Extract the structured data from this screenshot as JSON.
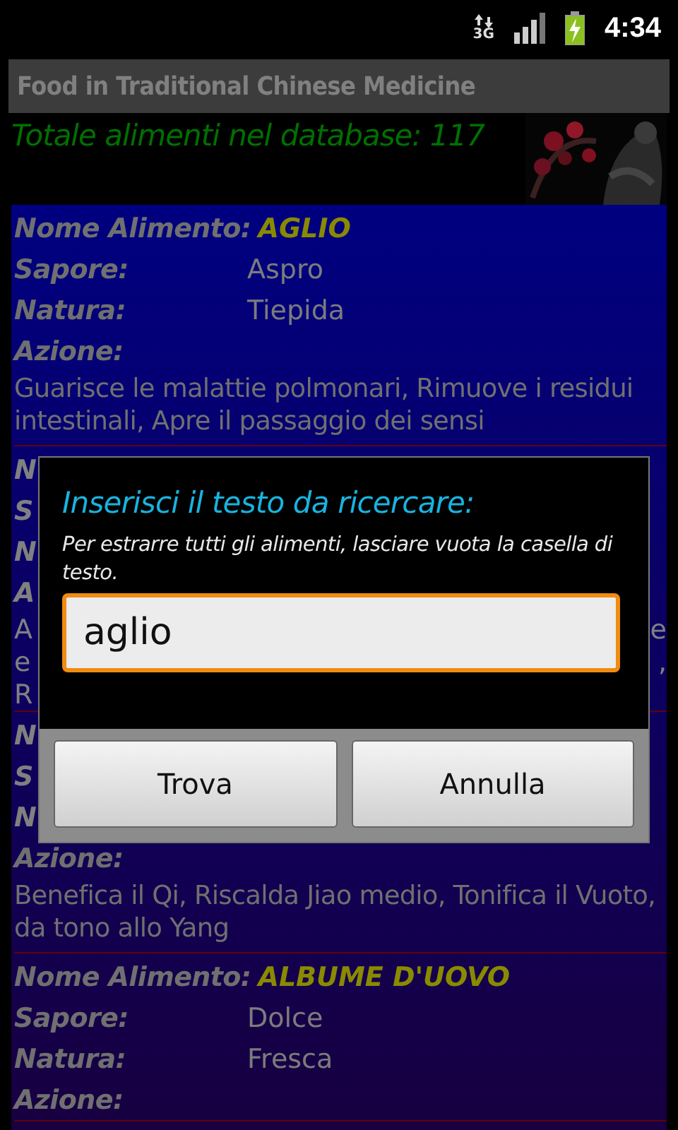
{
  "status_bar": {
    "network": "3G",
    "time": "4:34"
  },
  "window": {
    "title": "Food in Traditional Chinese Medicine"
  },
  "summary": "Totale alimenti nel database: 117",
  "entries": [
    {
      "rows": [
        {
          "kind": "name",
          "label": "Nome Alimento:",
          "value": "AGLIO"
        },
        {
          "kind": "field",
          "label": "Sapore:",
          "value": "Aspro"
        },
        {
          "kind": "field",
          "label": "Natura:",
          "value": "Tiepida"
        },
        {
          "kind": "heading",
          "label": "Azione:"
        },
        {
          "kind": "text",
          "text": "Guarisce le malattie polmonari, Rimuove i residui intestinali, Apre il passaggio dei sensi"
        }
      ]
    },
    {
      "rows": [
        {
          "kind": "fragment",
          "left": "N"
        },
        {
          "kind": "fragment",
          "left": "S"
        },
        {
          "kind": "fragment",
          "left": "N"
        },
        {
          "kind": "fragment",
          "left": "A"
        },
        {
          "kind": "fragment_line",
          "left": "A",
          "right": "e"
        },
        {
          "kind": "fragment_line",
          "left": "e",
          "right": ","
        },
        {
          "kind": "fragment_line",
          "left": "R"
        }
      ]
    },
    {
      "rows": [
        {
          "kind": "fragment",
          "left": "N"
        },
        {
          "kind": "fragment",
          "left": "S"
        },
        {
          "kind": "fragment",
          "left": "N"
        },
        {
          "kind": "heading",
          "label": "Azione:"
        },
        {
          "kind": "text",
          "text": "Benefica il Qi, Riscalda Jiao medio, Tonifica il Vuoto, da tono allo Yang"
        }
      ]
    },
    {
      "rows": [
        {
          "kind": "name",
          "label": "Nome Alimento:",
          "value": "ALBUME D'UOVO"
        },
        {
          "kind": "field",
          "label": "Sapore:",
          "value": "Dolce"
        },
        {
          "kind": "field",
          "label": "Natura:",
          "value": "Fresca"
        },
        {
          "kind": "heading",
          "label": "Azione:"
        }
      ]
    }
  ],
  "dialog": {
    "title": "Inserisci il testo da ricercare:",
    "message": "Per estrarre tutti gli alimenti, lasciare vuota la casella di testo.",
    "input": {
      "value": "aglio",
      "focused": true
    },
    "buttons": [
      {
        "label": "Trova"
      },
      {
        "label": "Annulla"
      }
    ]
  }
}
